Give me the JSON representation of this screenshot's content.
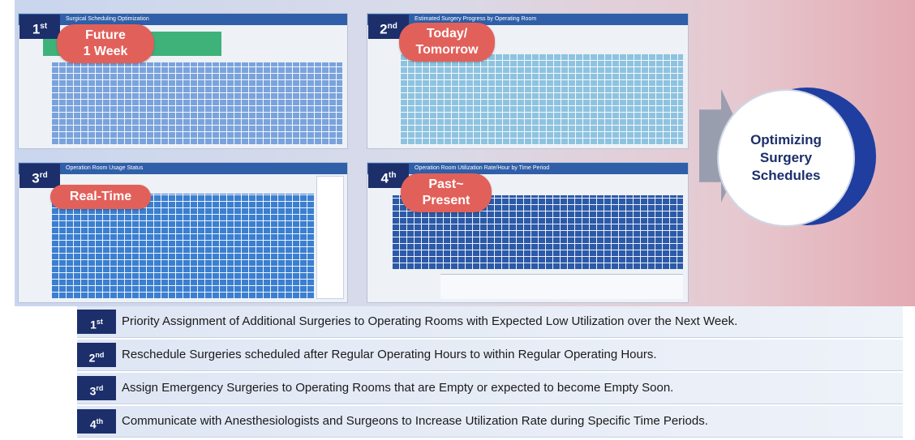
{
  "panels": [
    {
      "rank_num": "1",
      "rank_suffix": "st",
      "pill": "Future\n1 Week",
      "header": "Surgical Scheduling Optimization"
    },
    {
      "rank_num": "2",
      "rank_suffix": "nd",
      "pill": "Today/\nTomorrow",
      "header": "Estimated Surgery Progress by Operating Room"
    },
    {
      "rank_num": "3",
      "rank_suffix": "rd",
      "pill": "Real-Time",
      "header": "Operation Room Usage Status"
    },
    {
      "rank_num": "4",
      "rank_suffix": "th",
      "pill": "Past~\nPresent",
      "header": "Operation Room Utilization Rate/Hour by Time Period"
    }
  ],
  "center": {
    "label": "Optimizing\nSurgery\nSchedules"
  },
  "priorities": [
    {
      "num": "1",
      "suffix": "st",
      "text": "Priority Assignment of Additional Surgeries to Operating Rooms with Expected Low Utilization over the Next Week."
    },
    {
      "num": "2",
      "suffix": "nd",
      "text": "Reschedule Surgeries scheduled after Regular Operating Hours to within Regular Operating Hours."
    },
    {
      "num": "3",
      "suffix": "rd",
      "text": "Assign Emergency Surgeries to Operating Rooms that are Empty or expected to become Empty Soon."
    },
    {
      "num": "4",
      "suffix": "th",
      "text": "Communicate with Anesthesiologists and Surgeons to Increase Utilization Rate during Specific Time Periods."
    }
  ],
  "colors": {
    "navy": "#1c2f6b",
    "pill": "#e2605a",
    "header": "#2f5fa8"
  }
}
